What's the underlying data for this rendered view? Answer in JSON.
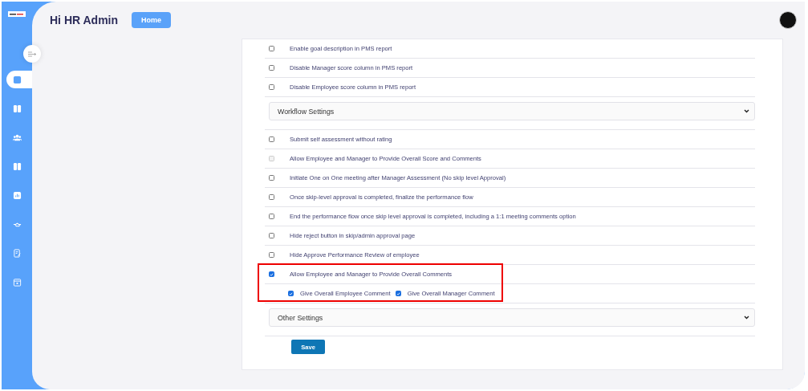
{
  "sidebar": {
    "items": [
      {
        "selected": true
      },
      {
        "selected": false
      },
      {
        "selected": false
      },
      {
        "selected": false
      },
      {
        "selected": false
      },
      {
        "selected": false
      },
      {
        "selected": false
      },
      {
        "selected": false
      }
    ]
  },
  "header": {
    "greeting": "Hi HR Admin",
    "home_button": "Home"
  },
  "rows": [
    {
      "kind": "option",
      "label": "Enable goal description in PMS report",
      "checked": false,
      "disabled": false,
      "highlighted": false
    },
    {
      "kind": "option",
      "label": "Disable Manager score column in PMS report",
      "checked": false,
      "disabled": false,
      "highlighted": false
    },
    {
      "kind": "option",
      "label": "Disable Employee score column in PMS report",
      "checked": false,
      "disabled": false,
      "highlighted": false
    },
    {
      "kind": "section",
      "label": "Workflow Settings",
      "highlighted": false
    },
    {
      "kind": "option",
      "label": "Submit self assessment without rating",
      "checked": false,
      "disabled": false,
      "highlighted": false
    },
    {
      "kind": "option",
      "label": "Allow Employee and Manager to Provide Overall Score and Comments",
      "checked": false,
      "disabled": true,
      "highlighted": false
    },
    {
      "kind": "option",
      "label": "Initiate One on One meeting after Manager Assessment (No skip level Approval)",
      "checked": false,
      "disabled": false,
      "highlighted": false
    },
    {
      "kind": "option",
      "label": "Once skip-level approval is completed, finalize the performance flow",
      "checked": false,
      "disabled": false,
      "highlighted": false
    },
    {
      "kind": "option",
      "label": "End the performance flow once skip level approval is completed, including a 1:1 meeting comments option",
      "checked": false,
      "disabled": false,
      "highlighted": false
    },
    {
      "kind": "option",
      "label": "Hide reject button in skip/admin approval page",
      "checked": false,
      "disabled": false,
      "highlighted": false
    },
    {
      "kind": "option",
      "label": "Hide Approve Performance Review of employee",
      "checked": false,
      "disabled": false,
      "highlighted": false
    },
    {
      "kind": "option",
      "label": "Allow Employee and Manager to Provide Overall Comments",
      "checked": true,
      "disabled": false,
      "highlighted": true
    },
    {
      "kind": "suboptions",
      "highlighted": true,
      "options": [
        {
          "label": "Give Overall Employee Comment",
          "checked": true
        },
        {
          "label": "Give Overall Manager Comment",
          "checked": true
        }
      ]
    },
    {
      "kind": "section",
      "label": "Other Settings",
      "highlighted": false
    }
  ],
  "save_button": "Save"
}
